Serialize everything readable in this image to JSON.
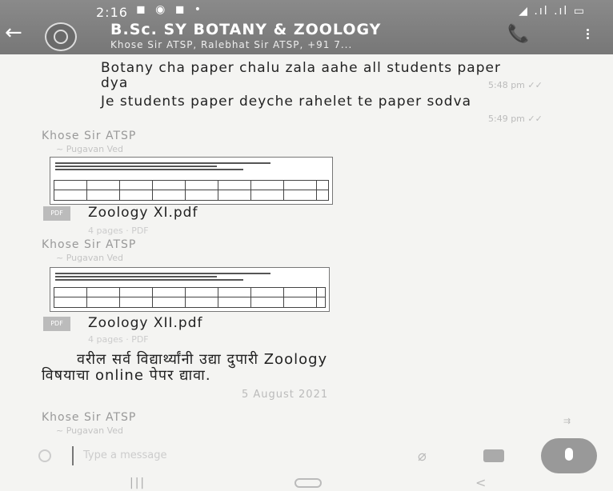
{
  "status_bar": {
    "time": "2:16",
    "icons": "◼ ◉ ◼ •",
    "right": "◢ .ıl .ıl ▭"
  },
  "header": {
    "title": "B.Sc. SY BOTANY & ZOOLOGY",
    "subtitle": "Khose Sir ATSP, Ralebhat Sir ATSP, +91 7..."
  },
  "messages": {
    "m1": {
      "text": "Botany cha paper chalu zala aahe all students paper dya",
      "time": "5:48 pm ✓✓"
    },
    "m2": {
      "text": "Je students paper deyche rahelet te paper sodva",
      "time": "5:49 pm ✓✓"
    }
  },
  "doc1": {
    "sender": "Khose Sir ATSP",
    "sender_sub": "~ Pugavan Ved",
    "icon_text": "PDF",
    "file_name": "Zoology XI.pdf",
    "meta": "4 pages · PDF"
  },
  "doc2": {
    "sender": "Khose Sir ATSP",
    "sender_sub": "~ Pugavan Ved",
    "icon_text": "PDF",
    "file_name": "Zoology XII.pdf",
    "meta": "4 pages · PDF"
  },
  "marathi_msg": {
    "line1": "वरील सर्व विद्यार्थ्यांनी उद्या दुपारी Zoology",
    "line2": "विषयाचा online पेपर द्यावा."
  },
  "date_separator": "5 August 2021",
  "last_sender": {
    "name": "Khose Sir ATSP",
    "sub": "~ Pugavan Ved"
  },
  "input": {
    "placeholder": "Type a message"
  },
  "nav": {
    "recent": "|||",
    "back": "<"
  }
}
